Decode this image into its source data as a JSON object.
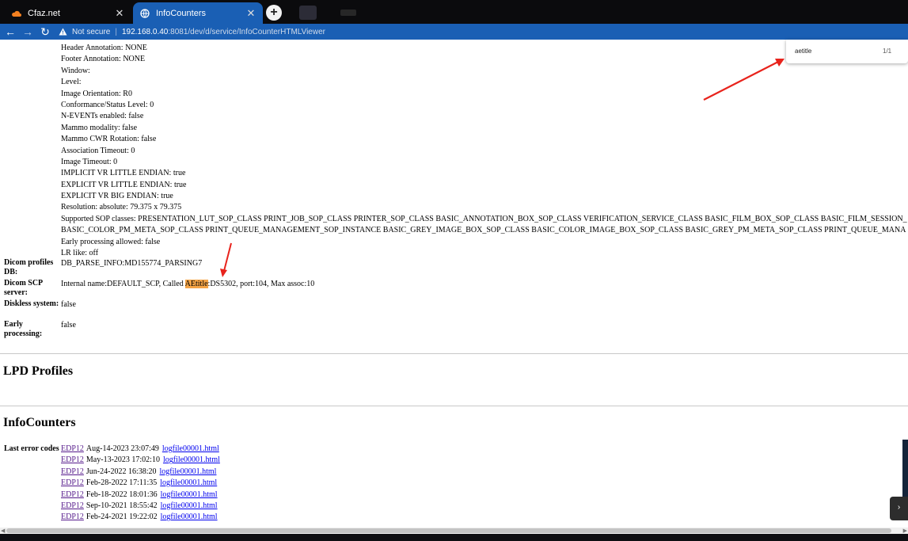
{
  "browser": {
    "tabs": [
      {
        "title": "Cfaz.net",
        "close": "✕"
      },
      {
        "title": "InfoCounters",
        "close": "✕"
      }
    ],
    "new_tab": "+",
    "address": {
      "security": "Not secure",
      "host": "192.168.0.40",
      "path": ":8081/dev/d/service/InfoCounterHTMLViewer"
    }
  },
  "find_bar": {
    "query": "aetitle",
    "count": "1/1"
  },
  "printer_profile_lines": [
    "Header Annotation: NONE",
    "Footer Annotation: NONE",
    "Window:",
    "Level:",
    "Image Orientation: R0",
    "Conformance/Status Level: 0",
    "N-EVENTs enabled: false",
    "Mammo modality: false",
    "Mammo CWR Rotation: false",
    "Association Timeout: 0",
    "Image Timeout: 0",
    "IMPLICIT VR LITTLE ENDIAN: true",
    "EXPLICIT VR LITTLE ENDIAN: true",
    "EXPLICIT VR BIG ENDIAN: true",
    "Resolution: absolute: 79.375 x 79.375",
    "Supported SOP classes: PRESENTATION_LUT_SOP_CLASS PRINT_JOB_SOP_CLASS PRINTER_SOP_CLASS BASIC_ANNOTATION_BOX_SOP_CLASS VERIFICATION_SERVICE_CLASS BASIC_FILM_BOX_SOP_CLASS BASIC_FILM_SESSION_",
    "BASIC_COLOR_PM_META_SOP_CLASS PRINT_QUEUE_MANAGEMENT_SOP_INSTANCE BASIC_GREY_IMAGE_BOX_SOP_CLASS BASIC_COLOR_IMAGE_BOX_SOP_CLASS BASIC_GREY_PM_META_SOP_CLASS PRINT_QUEUE_MANA",
    "Early processing allowed: false",
    "LR like: off"
  ],
  "props": {
    "dicom_profiles_db": {
      "label": "Dicom profiles DB:",
      "value": "DB_PARSE_INFO:MD155774_PARSING7"
    },
    "dicom_scp": {
      "label": "Dicom SCP server:",
      "value_before": "Internal name:DEFAULT_SCP, Called ",
      "highlight": "AEtitle",
      "value_after": ":DS5302, port:104, Max assoc:10"
    },
    "diskless": {
      "label": "Diskless system:",
      "value": "false"
    },
    "early_processing": {
      "label": "Early processing:",
      "value": "false"
    }
  },
  "sections": {
    "lpd": "LPD Profiles",
    "infocounters": "InfoCounters"
  },
  "error_codes": {
    "label": "Last error codes",
    "rows": [
      {
        "code": "EDP12",
        "date": "Aug-14-2023 23:07:49",
        "file": "logfile00001.html"
      },
      {
        "code": "EDP12",
        "date": "May-13-2023 17:02:10",
        "file": "logfile00001.html"
      },
      {
        "code": "EDP12",
        "date": "Jun-24-2022 16:38:20",
        "file": "logfile00001.html"
      },
      {
        "code": "EDP12",
        "date": "Feb-28-2022 17:11:35",
        "file": "logfile00001.html"
      },
      {
        "code": "EDP12",
        "date": "Feb-18-2022 18:01:36",
        "file": "logfile00001.html"
      },
      {
        "code": "EDP12",
        "date": "Sep-10-2021 18:55:42",
        "file": "logfile00001.html"
      },
      {
        "code": "EDP12",
        "date": "Feb-24-2021 19:22:02",
        "file": "logfile00001.html"
      }
    ]
  },
  "colors": {
    "tab_active": "#1a5fb4",
    "highlight": "#f5a446",
    "annotation_arrow": "#e8231c"
  }
}
